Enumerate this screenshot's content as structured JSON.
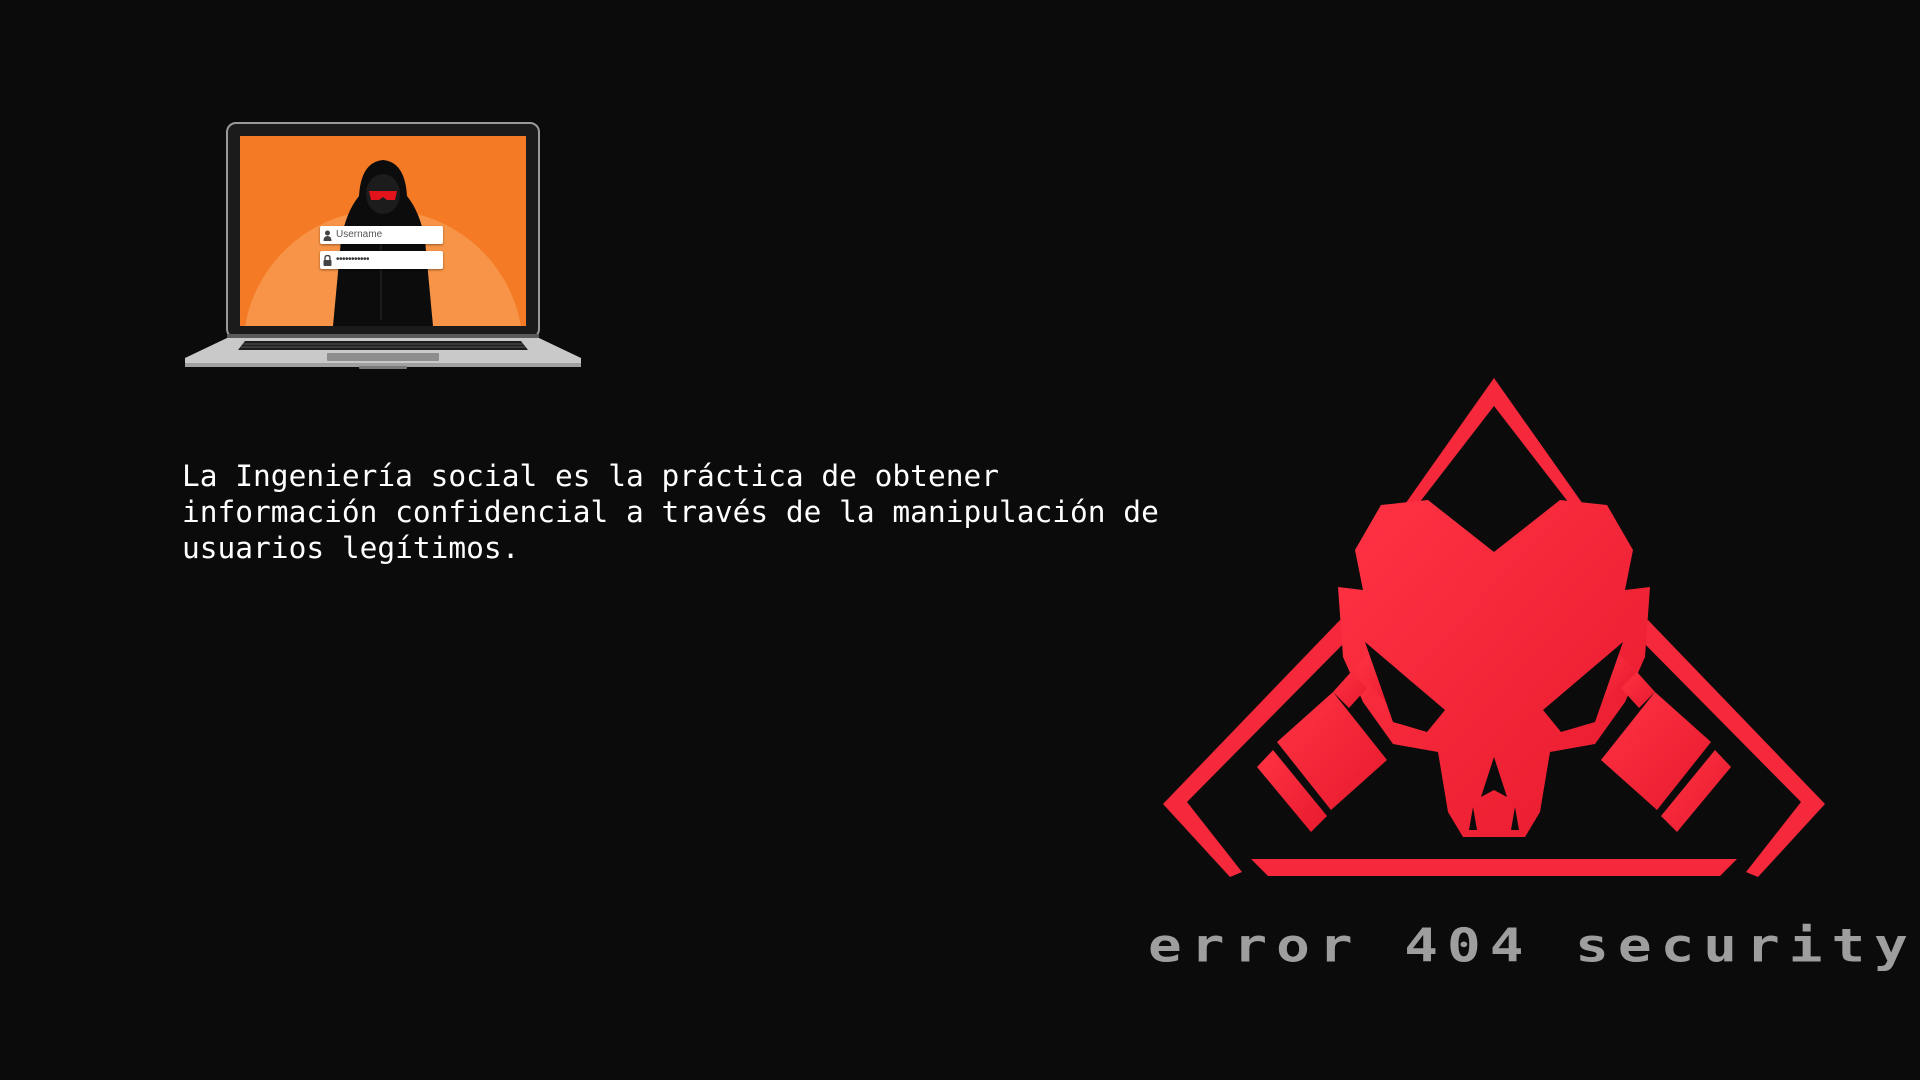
{
  "laptop": {
    "username_placeholder": "Username",
    "password_mask": "•••••••••••",
    "screen_color": "#f57a25",
    "icons": [
      "user-icon",
      "lock-icon"
    ]
  },
  "description": "La Ingeniería social es la práctica de obtener\ninformación confidencial a través de la manipulación de\nusuarios legítimos.",
  "brand": {
    "name": "error 404 security",
    "accent_color": "#f5283c",
    "text_color": "#9e9e9e",
    "logo_icon": "gas-mask-skull-triangle-icon"
  }
}
